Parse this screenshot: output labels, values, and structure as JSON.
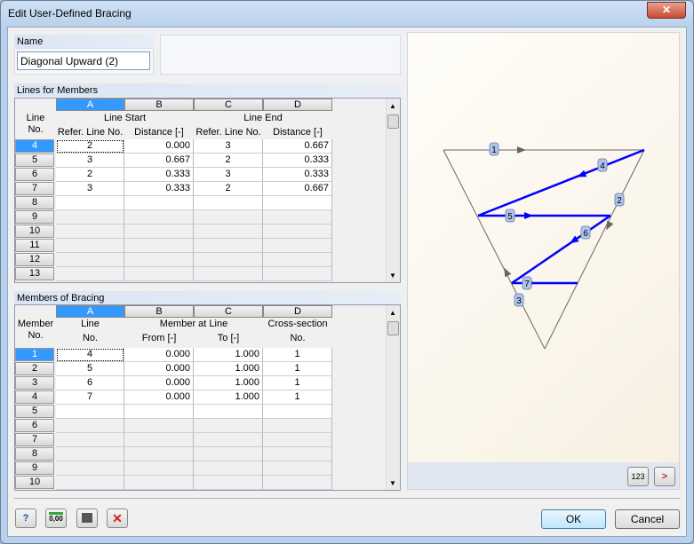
{
  "window": {
    "title": "Edit User-Defined Bracing",
    "close": "✕"
  },
  "name": {
    "label": "Name",
    "value": "Diagonal Upward (2)"
  },
  "lines_table": {
    "title": "Lines for Members",
    "columns": [
      "A",
      "B",
      "C",
      "D"
    ],
    "row_header": [
      "Line",
      "No."
    ],
    "groups": [
      "Line Start",
      "Line End"
    ],
    "subheaders": [
      "Refer. Line No.",
      "Distance [-]",
      "Refer. Line No.",
      "Distance [-]"
    ],
    "rows": [
      {
        "no": "4",
        "a": "2",
        "b": "0.000",
        "c": "3",
        "d": "0.667"
      },
      {
        "no": "5",
        "a": "3",
        "b": "0.667",
        "c": "2",
        "d": "0.333"
      },
      {
        "no": "6",
        "a": "2",
        "b": "0.333",
        "c": "3",
        "d": "0.333"
      },
      {
        "no": "7",
        "a": "3",
        "b": "0.333",
        "c": "2",
        "d": "0.667"
      },
      {
        "no": "8"
      },
      {
        "no": "9"
      },
      {
        "no": "10"
      },
      {
        "no": "11"
      },
      {
        "no": "12"
      },
      {
        "no": "13"
      }
    ]
  },
  "members_table": {
    "title": "Members of Bracing",
    "columns": [
      "A",
      "B",
      "C",
      "D"
    ],
    "row_header": [
      "Member",
      "No."
    ],
    "headers_top": [
      "Line",
      "Member at Line",
      "Cross-section"
    ],
    "headers_bottom": [
      "No.",
      "From [-]",
      "To [-]",
      "No."
    ],
    "rows": [
      {
        "no": "1",
        "a": "4",
        "b": "0.000",
        "c": "1.000",
        "d": "1"
      },
      {
        "no": "2",
        "a": "5",
        "b": "0.000",
        "c": "1.000",
        "d": "1"
      },
      {
        "no": "3",
        "a": "6",
        "b": "0.000",
        "c": "1.000",
        "d": "1"
      },
      {
        "no": "4",
        "a": "7",
        "b": "0.000",
        "c": "1.000",
        "d": "1"
      },
      {
        "no": "5"
      },
      {
        "no": "6"
      },
      {
        "no": "7"
      },
      {
        "no": "8"
      },
      {
        "no": "9"
      },
      {
        "no": "10"
      }
    ]
  },
  "diagram": {
    "labels": [
      "1",
      "2",
      "3",
      "4",
      "5",
      "6",
      "7"
    ],
    "bracing_color": "#0000ff",
    "frame_color": "#666666"
  },
  "preview_buttons": {
    "numbering": "123",
    "next": ">"
  },
  "footer": {
    "ok": "OK",
    "cancel": "Cancel",
    "icons": [
      "help-icon",
      "units-decimal-icon",
      "calculator-icon",
      "delete-icon"
    ],
    "decimal_label": "0,00"
  }
}
